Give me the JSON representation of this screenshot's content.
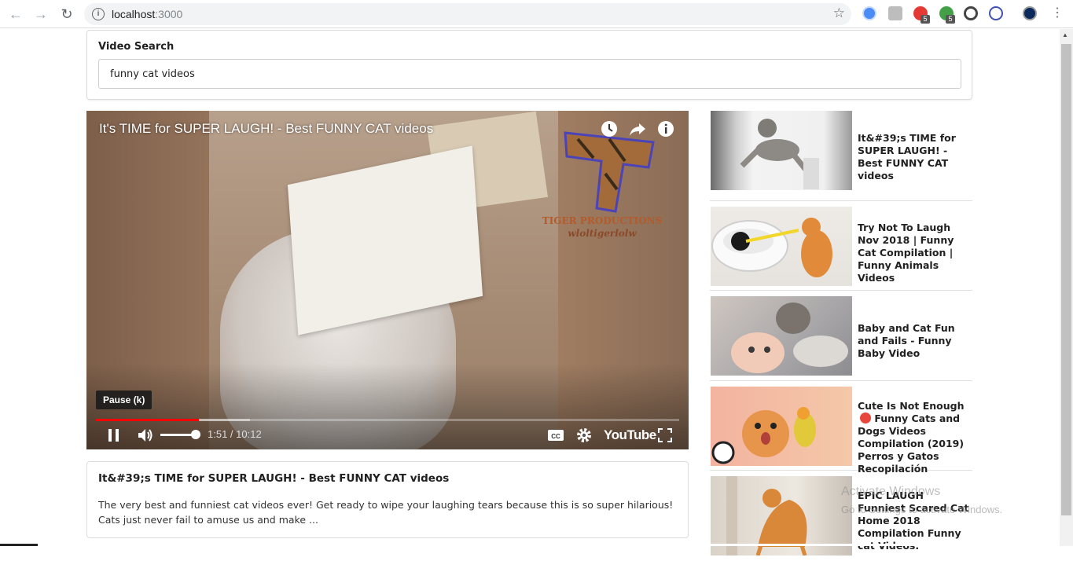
{
  "browser": {
    "url_host": "localhost",
    "url_port": ":3000",
    "ext_badges": [
      "5",
      "5"
    ]
  },
  "search": {
    "label": "Video Search",
    "value": "funny cat videos"
  },
  "player": {
    "title": "It's TIME for SUPER LAUGH! - Best FUNNY CAT videos",
    "watermark_line1": "TIGER PRODUCTIONS",
    "watermark_line2": "wloltigerlolw",
    "tooltip": "Pause (k)",
    "time": "1:51 / 10:12",
    "progress_played": 0.177,
    "progress_buffered": 0.264,
    "volume": 0.9,
    "brand": "YouTube",
    "accent": "#ff0000"
  },
  "detail": {
    "title": "It&#39;s TIME for SUPER LAUGH! - Best FUNNY CAT videos",
    "description": "The very best and funniest cat videos ever! Get ready to wipe your laughing tears because this is so super hilarious! Cats just never fail to amuse us and make ..."
  },
  "videos": [
    {
      "title": "It&#39;s TIME for SUPER LAUGH! - Best FUNNY CAT videos"
    },
    {
      "title": "Try Not To Laugh Nov 2018 | Funny Cat Compilation | Funny Animals Videos"
    },
    {
      "title": "Baby and Cat Fun and Fails - Funny Baby Video"
    },
    {
      "title": "Cute Is Not Enough",
      "title_rest": "Funny Cats and Dogs Videos Compilation (2019) Perros y Gatos Recopilación"
    },
    {
      "title": "EPIC LAUGH Funniest Scared Cat Home 2018 Compilation Funny cat Videos."
    }
  ],
  "os_overlay": {
    "line1": "Activate Windows",
    "line2": "Go to Settings to activate Windows."
  }
}
